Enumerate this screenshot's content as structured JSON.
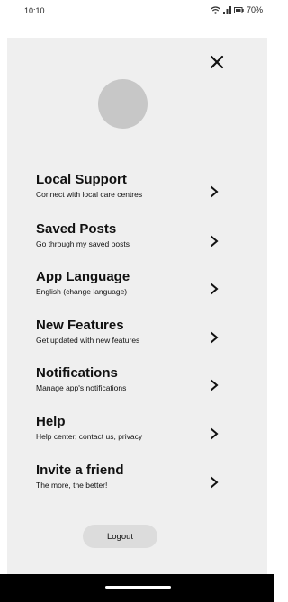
{
  "status_bar": {
    "time": "10:10",
    "battery": "70%",
    "icons": [
      "wifi-icon",
      "signal-icon",
      "battery-icon"
    ]
  },
  "menu": {
    "close_icon": "close-icon",
    "avatar_color": "#c7c7c7",
    "items": [
      {
        "title": "Local Support",
        "subtitle": "Connect with local care centres"
      },
      {
        "title": "Saved Posts",
        "subtitle": "Go through my saved posts"
      },
      {
        "title": "App Language",
        "subtitle": "English (change language)"
      },
      {
        "title": "New Features",
        "subtitle": "Get updated with new features"
      },
      {
        "title": "Notifications",
        "subtitle": "Manage app's notifications"
      },
      {
        "title": "Help",
        "subtitle": "Help center, contact us, privacy"
      },
      {
        "title": "Invite a friend",
        "subtitle": "The more, the better!"
      }
    ],
    "logout_label": "Logout"
  },
  "colors": {
    "panel_background": "#efefef",
    "logout_button": "#dcdcdc",
    "navigation_bar": "#000000"
  }
}
